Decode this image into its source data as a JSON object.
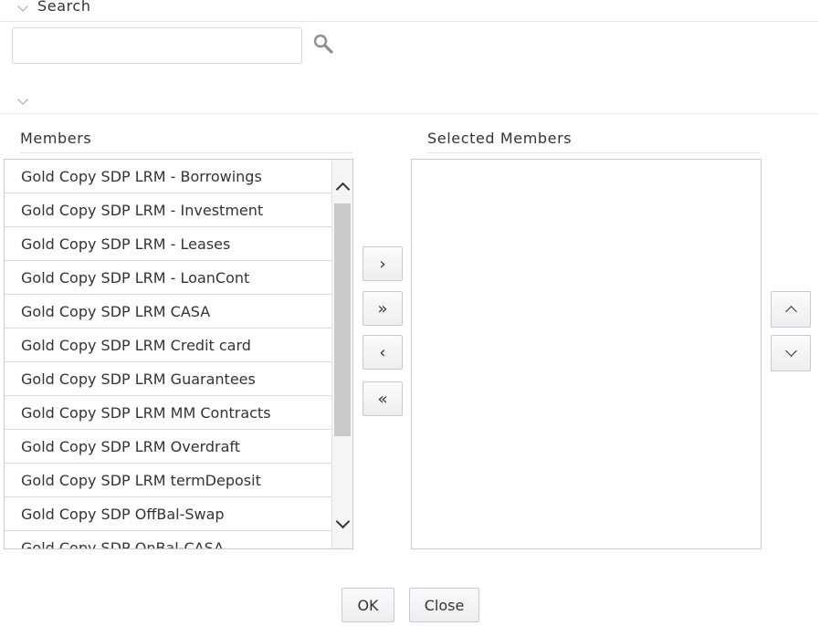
{
  "search": {
    "title": "Search",
    "value": "",
    "placeholder": ""
  },
  "members": {
    "label": "Members",
    "items": [
      "Gold Copy SDP LRM - Borrowings",
      "Gold Copy SDP LRM - Investment",
      "Gold Copy SDP LRM - Leases",
      "Gold Copy SDP LRM - LoanCont",
      "Gold Copy SDP LRM CASA",
      "Gold Copy SDP LRM Credit card",
      "Gold Copy SDP LRM Guarantees",
      "Gold Copy SDP LRM MM Contracts",
      "Gold Copy SDP LRM Overdraft",
      "Gold Copy SDP LRM termDeposit",
      "Gold Copy SDP OffBal-Swap",
      "Gold Copy SDP OnBal-CASA"
    ]
  },
  "selected": {
    "label": "Selected Members",
    "items": []
  },
  "transfer": {
    "move_right": "›",
    "move_all_right": "»",
    "move_left": "‹",
    "move_all_left": "«"
  },
  "icons": {
    "search": "search-icon",
    "collapse": "chevron-down-icon",
    "up": "chevron-up-icon",
    "down": "chevron-down-icon"
  },
  "footer": {
    "ok_label": "OK",
    "close_label": "Close"
  },
  "colors": {
    "border": "#c8ccd1",
    "scroll_thumb": "#c9c9c9",
    "text": "#333333"
  }
}
